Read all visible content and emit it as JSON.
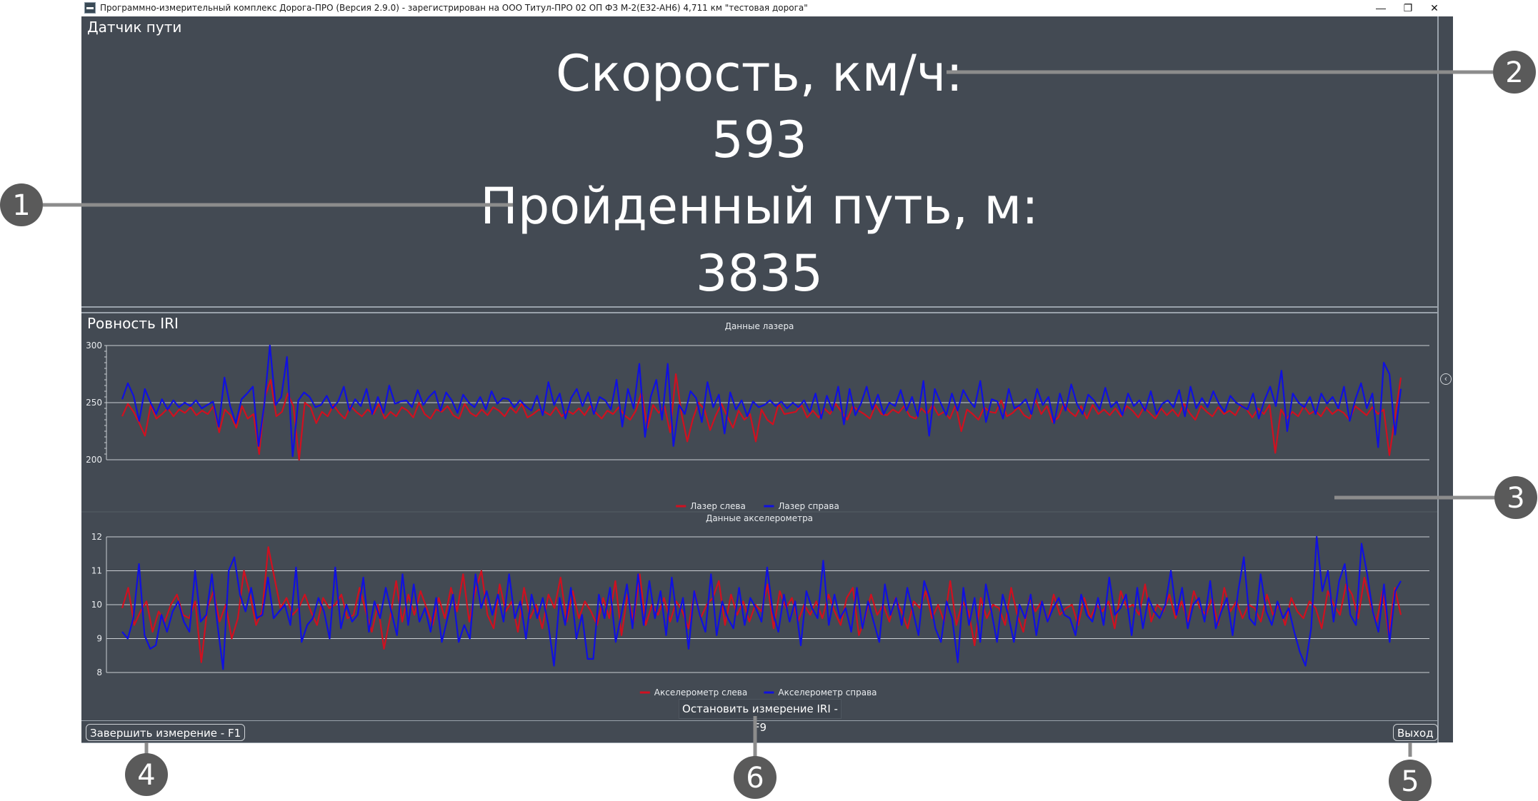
{
  "window": {
    "title": "Программно-измерительный комплекс Дорога-ПРО (Версия 2.9.0) - зарегистрирован на ООО Титул-ПРО 02 ОП ФЗ М-2(Е32-АН6) 4,711 км \"тестовая дорога\"",
    "controls": {
      "minimize": "—",
      "restore": "❐",
      "close": "✕"
    }
  },
  "sensor_panel": {
    "title": "Датчик пути",
    "speed_label": "Скорость, км/ч:",
    "speed_value": "593",
    "distance_label": "Пройденный путь, м:",
    "distance_value": "3835"
  },
  "iri_panel": {
    "title": "Ровность IRI",
    "collapse_icon": "‹"
  },
  "colors": {
    "left_series": "#d01020",
    "right_series": "#1010e0",
    "background": "#434a53",
    "gridline": "#c9ced3"
  },
  "chart_data": [
    {
      "type": "line",
      "title": "Данные лазера",
      "ylim": [
        200,
        300
      ],
      "yticks": [
        "300",
        "250",
        "200"
      ],
      "grid": true,
      "legend_position": "bottom-center",
      "series": [
        {
          "name": "Лазер слева",
          "color": "#d01020",
          "values": [
            238,
            249,
            242,
            232,
            221,
            248,
            236,
            240,
            245,
            238,
            244,
            241,
            246,
            239,
            243,
            240,
            247,
            224,
            244,
            239,
            228,
            247,
            236,
            240,
            205,
            255,
            270,
            238,
            242,
            258,
            247,
            200,
            250,
            246,
            232,
            242,
            238,
            248,
            241,
            236,
            247,
            242,
            238,
            244,
            240,
            249,
            236,
            242,
            238,
            246,
            243,
            237,
            250,
            240,
            236,
            244,
            242,
            247,
            239,
            236,
            249,
            241,
            238,
            244,
            239,
            246,
            243,
            238,
            246,
            241,
            249,
            237,
            240,
            244,
            242,
            239,
            246,
            238,
            243,
            240,
            245,
            239,
            247,
            241,
            236,
            243,
            240,
            246,
            239,
            235,
            243,
            259,
            228,
            248,
            241,
            247,
            224,
            275,
            240,
            216,
            236,
            250,
            244,
            226,
            239,
            249,
            238,
            228,
            243,
            235,
            240,
            216,
            244,
            235,
            231,
            249,
            240,
            241,
            242,
            248,
            237,
            243,
            237,
            245,
            240,
            249,
            242,
            235,
            247,
            243,
            240,
            236,
            248,
            240,
            239,
            244,
            241,
            247,
            238,
            236,
            245,
            240,
            248,
            239,
            242,
            236,
            248,
            225,
            244,
            240,
            235,
            246,
            242,
            241,
            252,
            238,
            241,
            246,
            239,
            236,
            253,
            240,
            247,
            233,
            237,
            249,
            242,
            238,
            247,
            236,
            248,
            240,
            244,
            239,
            245,
            238,
            247,
            243,
            237,
            246,
            241,
            236,
            245,
            239,
            244,
            238,
            249,
            241,
            235,
            247,
            242,
            238,
            246,
            240,
            243,
            239,
            248,
            244,
            237,
            245,
            240,
            248,
            206,
            244,
            236,
            242,
            238,
            247,
            240,
            243,
            238,
            246,
            240,
            244,
            241,
            235,
            247,
            243,
            239,
            246,
            240,
            244,
            204,
            238,
            272
          ],
          "note": ""
        },
        {
          "name": "Лазер справа",
          "color": "#1010e0",
          "values": [
            253,
            267,
            256,
            234,
            262,
            250,
            240,
            253,
            244,
            252,
            246,
            250,
            247,
            252,
            245,
            248,
            251,
            229,
            272,
            247,
            232,
            253,
            258,
            264,
            212,
            248,
            300,
            248,
            255,
            290,
            203,
            252,
            259,
            255,
            246,
            248,
            256,
            245,
            251,
            264,
            243,
            253,
            247,
            262,
            240,
            255,
            241,
            265,
            249,
            251,
            252,
            246,
            261,
            248,
            255,
            260,
            243,
            259,
            252,
            241,
            257,
            250,
            246,
            255,
            244,
            260,
            249,
            254,
            253,
            246,
            252,
            247,
            243,
            256,
            239,
            268,
            248,
            258,
            236,
            254,
            262,
            247,
            259,
            240,
            255,
            252,
            244,
            270,
            229,
            262,
            245,
            284,
            220,
            255,
            270,
            235,
            284,
            212,
            248,
            240,
            260,
            254,
            233,
            268,
            246,
            257,
            223,
            259,
            244,
            252,
            238,
            251,
            246,
            248,
            252,
            247,
            251,
            245,
            250,
            246,
            252,
            242,
            258,
            236,
            256,
            243,
            264,
            231,
            262,
            239,
            249,
            264,
            244,
            257,
            240,
            250,
            247,
            261,
            243,
            255,
            238,
            269,
            221,
            262,
            250,
            239,
            258,
            243,
            261,
            252,
            246,
            269,
            233,
            253,
            251,
            236,
            262,
            245,
            248,
            253,
            240,
            262,
            248,
            255,
            232,
            258,
            243,
            266,
            249,
            240,
            257,
            252,
            244,
            263,
            246,
            251,
            239,
            258,
            247,
            252,
            243,
            260,
            240,
            249,
            252,
            246,
            261,
            238,
            264,
            245,
            254,
            246,
            260,
            249,
            242,
            256,
            250,
            247,
            244,
            258,
            236,
            252,
            264,
            247,
            278,
            225,
            258,
            250,
            246,
            255,
            240,
            258,
            249,
            255,
            245,
            264,
            234,
            253,
            267,
            245,
            258,
            211,
            285,
            275,
            222,
            262
          ]
        }
      ]
    },
    {
      "type": "line",
      "title": "Данные акселерометра",
      "ylim": [
        8,
        12
      ],
      "yticks": [
        "12",
        "11",
        "10",
        "9",
        "8"
      ],
      "grid": true,
      "legend_position": "bottom-center",
      "series": [
        {
          "name": "Акселерометр слева",
          "color": "#d01020",
          "values": [
            9.9,
            10.5,
            9.4,
            9.8,
            10.1,
            9.2,
            9.8,
            9.5,
            10.0,
            10.3,
            9.7,
            9.6,
            10.1,
            8.3,
            9.9,
            10.4,
            9.5,
            10.0,
            9.0,
            9.6,
            11.0,
            10.3,
            9.4,
            9.8,
            11.7,
            10.8,
            9.9,
            10.2,
            9.7,
            9.9,
            10.3,
            9.8,
            9.4,
            10.2,
            9.9,
            10.0,
            10.3,
            9.6,
            9.7,
            10.5,
            9.8,
            9.2,
            10.0,
            8.7,
            9.6,
            10.7,
            9.5,
            10.3,
            9.7,
            10.4,
            9.9,
            9.4,
            10.2,
            9.6,
            10.5,
            9.8,
            10.9,
            9.5,
            10.4,
            11.0,
            9.7,
            9.3,
            10.6,
            9.8,
            10.1,
            9.2,
            10.5,
            9.6,
            10.0,
            9.3,
            10.3,
            9.9,
            10.8,
            9.5,
            10.4,
            9.6,
            10.1,
            9.8,
            9.4,
            10.2,
            9.6,
            10.7,
            9.1,
            10.3,
            9.5,
            10.9,
            9.4,
            10.0,
            9.7,
            10.2,
            9.5,
            10.1,
            9.8,
            9.3,
            10.4,
            9.6,
            10.0,
            10.2,
            10.7,
            9.4,
            10.3,
            9.7,
            10.1,
            9.5,
            10.0,
            9.8,
            10.6,
            9.3,
            10.4,
            9.9,
            10.2,
            9.5,
            10.0,
            9.7,
            10.1,
            9.6,
            10.3,
            9.8,
            9.4,
            10.2,
            10.5,
            9.1,
            9.6,
            10.3,
            9.7,
            10.0,
            9.5,
            10.2,
            9.8,
            9.3,
            10.1,
            9.9,
            10.4,
            9.6,
            10.0,
            9.5,
            10.7,
            9.4,
            10.1,
            9.8,
            8.8,
            10.2,
            9.6,
            10.0,
            9.9,
            9.4,
            10.5,
            9.7,
            9.2,
            10.2,
            9.8,
            10.1,
            9.5,
            10.3,
            9.7,
            9.9,
            10.0,
            9.4,
            10.2,
            9.6,
            10.0,
            9.8,
            10.1,
            9.3,
            10.4,
            9.9,
            10.0,
            9.7,
            10.6,
            9.5,
            10.0,
            9.8,
            10.3,
            9.6,
            10.1,
            9.5,
            10.4,
            9.9,
            9.7,
            10.2,
            9.4,
            10.5,
            9.8,
            10.1,
            9.6,
            10.0,
            9.9,
            9.5,
            10.3,
            9.7,
            10.0,
            9.4,
            10.2,
            9.8,
            9.6,
            10.1,
            9.9,
            9.3,
            10.4,
            10.0,
            9.7,
            10.6,
            10.3,
            9.6,
            10.8,
            10.0,
            9.5,
            10.4,
            9.1,
            10.5,
            9.7
          ],
          "note": ""
        },
        {
          "name": "Акселерометр справа",
          "color": "#1010e0",
          "values": [
            9.2,
            9.0,
            9.6,
            11.2,
            9.1,
            8.7,
            8.8,
            9.7,
            9.2,
            9.8,
            10.1,
            9.5,
            9.2,
            11.0,
            9.5,
            9.7,
            10.9,
            9.4,
            8.1,
            11.0,
            11.4,
            10.3,
            9.8,
            10.5,
            9.6,
            9.7,
            10.8,
            9.6,
            9.8,
            10.0,
            9.4,
            11.1,
            8.9,
            9.4,
            9.6,
            10.2,
            9.8,
            9.0,
            11.1,
            9.3,
            10.0,
            9.5,
            9.7,
            10.8,
            9.2,
            10.1,
            9.6,
            10.5,
            9.8,
            9.1,
            10.9,
            9.4,
            10.6,
            9.5,
            9.9,
            9.2,
            10.2,
            8.9,
            9.6,
            10.3,
            8.9,
            9.4,
            9.0,
            10.9,
            9.9,
            10.4,
            9.7,
            10.3,
            9.5,
            10.9,
            9.6,
            10.1,
            9.0,
            10.3,
            9.6,
            10.2,
            9.4,
            8.2,
            10.2,
            9.4,
            10.5,
            9.0,
            9.7,
            8.4,
            8.4,
            10.3,
            9.6,
            10.5,
            8.9,
            9.7,
            10.6,
            9.3,
            10.9,
            9.4,
            10.7,
            9.6,
            10.4,
            9.1,
            10.8,
            9.5,
            10.2,
            8.7,
            10.4,
            9.7,
            9.2,
            10.9,
            9.1,
            10.1,
            9.6,
            9.3,
            10.5,
            9.4,
            10.2,
            9.9,
            9.5,
            11.1,
            9.8,
            9.2,
            10.3,
            9.5,
            10.1,
            8.8,
            10.4,
            9.9,
            9.6,
            11.3,
            9.4,
            10.3,
            9.6,
            9.9,
            9.2,
            10.5,
            9.3,
            10.1,
            9.5,
            8.9,
            10.6,
            9.7,
            10.2,
            9.4,
            10.5,
            9.8,
            9.1,
            10.7,
            10.2,
            9.3,
            8.9,
            10.1,
            9.6,
            8.3,
            10.5,
            9.4,
            10.2,
            8.9,
            10.6,
            9.8,
            8.9,
            10.3,
            9.7,
            8.9,
            10.0,
            9.6,
            10.3,
            9.1,
            10.1,
            9.5,
            9.9,
            10.2,
            9.7,
            9.6,
            9.1,
            10.3,
            9.7,
            9.5,
            10.2,
            9.4,
            10.8,
            9.7,
            9.9,
            10.3,
            9.1,
            10.5,
            9.3,
            10.2,
            9.8,
            9.6,
            10.0,
            11.0,
            9.7,
            10.5,
            9.3,
            10.0,
            10.2,
            9.5,
            10.7,
            9.3,
            9.8,
            10.2,
            9.1,
            10.4,
            11.4,
            9.6,
            9.4,
            10.9,
            9.8,
            9.4,
            10.1,
            9.6,
            9.9,
            9.2,
            8.6,
            8.2,
            9.3,
            12.0,
            10.4,
            11.0,
            9.5,
            10.7,
            11.2,
            9.7,
            9.4,
            11.8,
            10.9,
            9.8,
            9.2,
            10.6,
            8.9,
            10.4,
            10.7
          ]
        }
      ]
    }
  ],
  "buttons": {
    "stop_iri": "Остановить измерение IRI - F9",
    "finish": "Завершить измерение - F1",
    "exit": "Выход"
  },
  "callouts": [
    "1",
    "2",
    "3",
    "4",
    "5",
    "6"
  ]
}
